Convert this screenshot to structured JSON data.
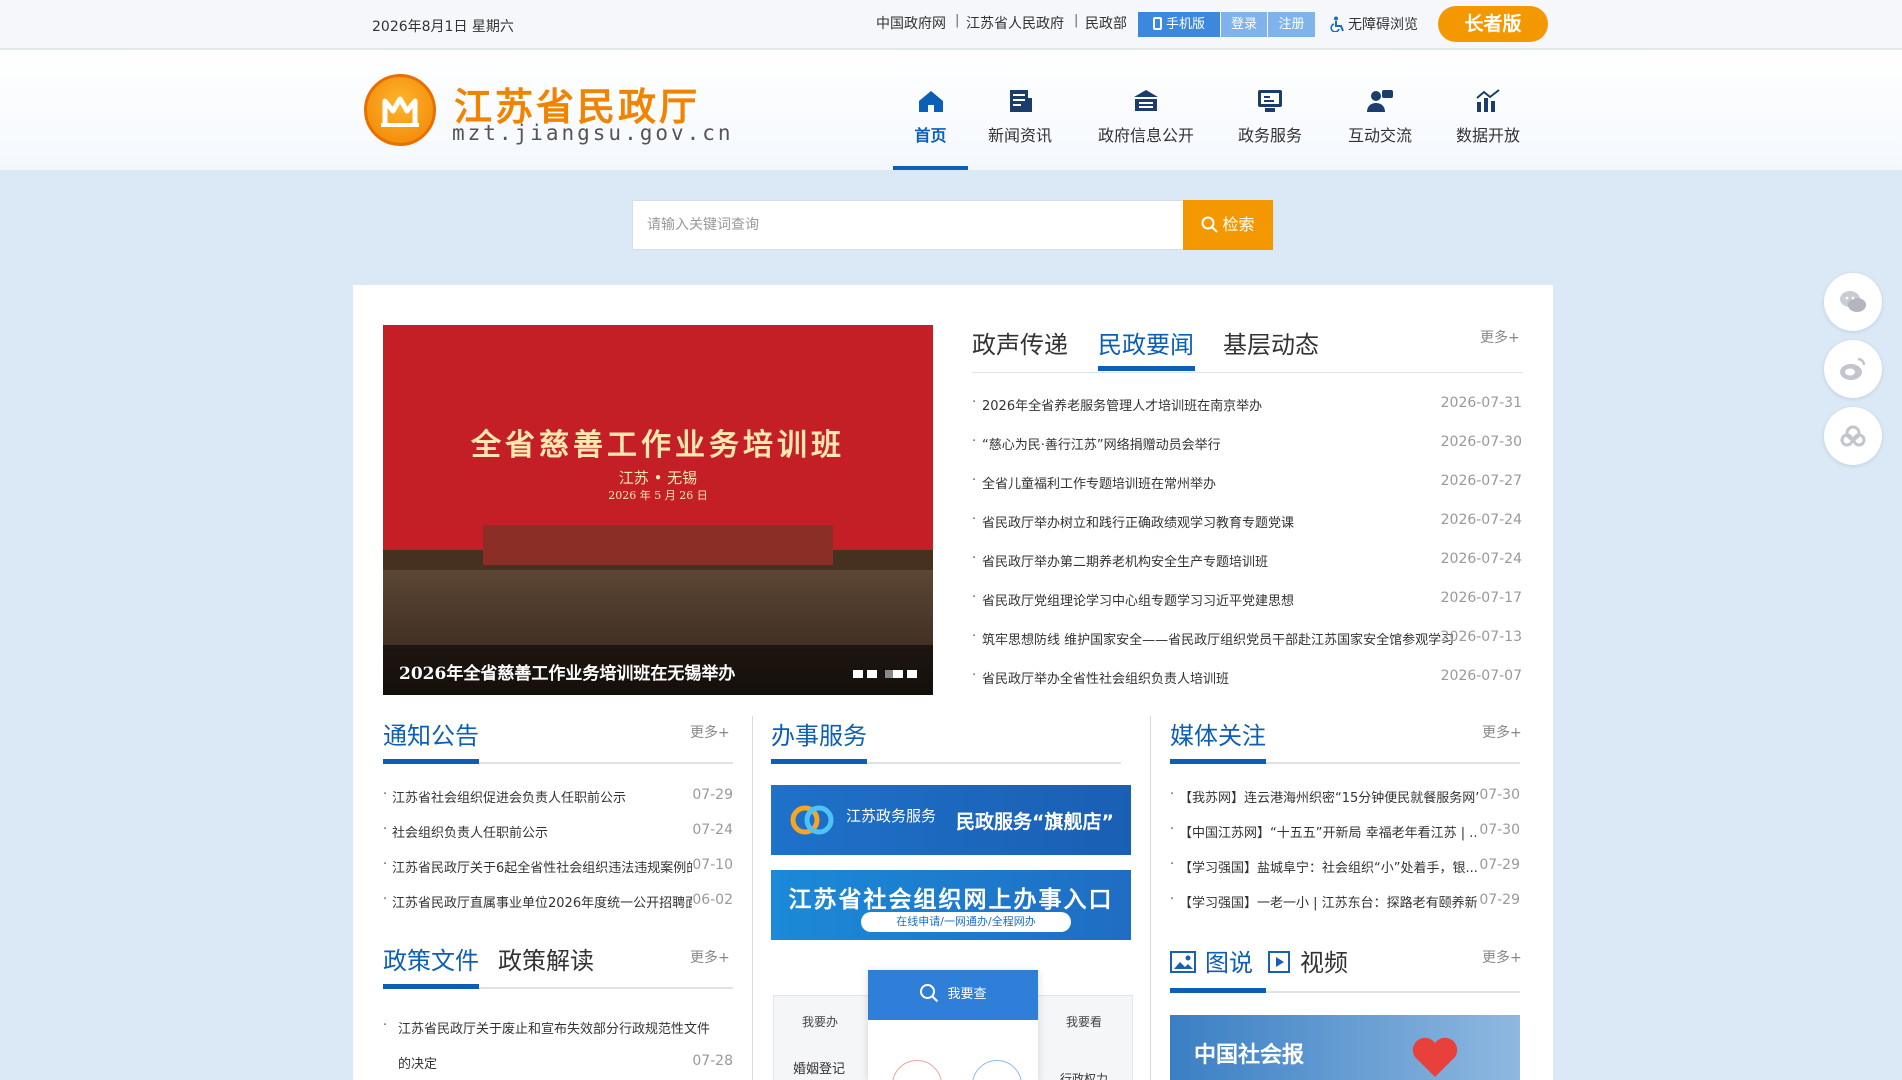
{
  "topbar": {
    "date": "2026年8月1日 星期六",
    "links": [
      "中国政府网",
      "江苏省人民政府",
      "民政部"
    ],
    "mobile": "手机版",
    "login": "登录",
    "register": "注册",
    "accessible": "无障碍浏览",
    "elder": "长者版"
  },
  "logo": {
    "cn": "江苏省民政厅",
    "en": "mzt.jiangsu.gov.cn"
  },
  "nav": [
    {
      "label": "首页",
      "icon": "home-icon",
      "active": true
    },
    {
      "label": "新闻资讯",
      "icon": "news-icon"
    },
    {
      "label": "政府信息公开",
      "icon": "gov-info-icon"
    },
    {
      "label": "政务服务",
      "icon": "service-icon"
    },
    {
      "label": "互动交流",
      "icon": "interact-icon"
    },
    {
      "label": "数据开放",
      "icon": "data-icon"
    }
  ],
  "search": {
    "placeholder": "请输入关键词查询",
    "button": "检索"
  },
  "slide": {
    "banner_title": "全省慈善工作业务培训班",
    "banner_sub": "江苏 • 无锡",
    "banner_date": "2026 年 5 月 26 日",
    "caption": "2026年全省慈善工作业务培训班在无锡举办"
  },
  "news": {
    "tabs": [
      "政声传递",
      "民政要闻",
      "基层动态"
    ],
    "active_tab": "民政要闻",
    "more": "更多+",
    "items": [
      {
        "title": "2026年全省养老服务管理人才培训班在南京举办",
        "date": "2026-07-31"
      },
      {
        "title": "“慈心为民·善行江苏”网络捐赠动员会举行",
        "date": "2026-07-30"
      },
      {
        "title": "全省儿童福利工作专题培训班在常州举办",
        "date": "2026-07-27"
      },
      {
        "title": "省民政厅举办树立和践行正确政绩观学习教育专题党课",
        "date": "2026-07-24"
      },
      {
        "title": "省民政厅举办第二期养老机构安全生产专题培训班",
        "date": "2026-07-24"
      },
      {
        "title": "省民政厅党组理论学习中心组专题学习习近平党建思想",
        "date": "2026-07-17"
      },
      {
        "title": "筑牢思想防线 维护国家安全——省民政厅组织党员干部赴江苏国家安全馆参观学习",
        "date": "2026-07-13"
      },
      {
        "title": "省民政厅举办全省性社会组织负责人培训班",
        "date": "2026-07-07"
      }
    ]
  },
  "notice": {
    "title": "通知公告",
    "more": "更多+",
    "items": [
      {
        "title": "江苏省社会组织促进会负责人任职前公示",
        "date": "07-29"
      },
      {
        "title": "社会组织负责人任职前公示",
        "date": "07-24"
      },
      {
        "title": "江苏省民政厅关于6起全省性社会组织违法违规案例的...",
        "date": "07-10"
      },
      {
        "title": "江苏省民政厅直属事业单位2026年度统一公开招聘面...",
        "date": "06-02"
      }
    ]
  },
  "policy": {
    "tabs": [
      "政策文件",
      "政策解读"
    ],
    "more": "更多+",
    "items": [
      {
        "title_line1": "江苏省民政厅关于废止和宣布失效部分行政规范性文件",
        "title_line2": "的决定",
        "date": "07-28"
      }
    ]
  },
  "service": {
    "title": "办事服务",
    "banner1_sub": "江苏政务服务",
    "banner1_text": "民政服务“旗舰店”",
    "banner2_text": "江苏省社会组织网上办事入口",
    "banner2_pill": "在线申请/一网通办/全程网办",
    "query_left": "我要办",
    "query_center": "我要查",
    "query_right": "我要看",
    "item_left": "婚姻登记",
    "item_right": "行政权力"
  },
  "media": {
    "title": "媒体关注",
    "more": "更多+",
    "items": [
      {
        "title": "【我苏网】连云港海州织密“15分钟便民就餐服务网”",
        "date": "07-30"
      },
      {
        "title": "【中国江苏网】“十五五”开新局 幸福老年看江苏 | ...",
        "date": "07-30"
      },
      {
        "title": "【学习强国】盐城阜宁：社会组织“小”处着手，银...",
        "date": "07-29"
      },
      {
        "title": "【学习强国】一老一小 | 江苏东台：探路老有颐养新...",
        "date": "07-29"
      }
    ],
    "tabs": [
      "图说",
      "视频"
    ],
    "more2": "更多+",
    "image_text": "中国社会报"
  },
  "float": [
    "wechat-icon",
    "weibo-icon",
    "cloud-icon"
  ],
  "colors": {
    "brand_blue": "#0d5fb5",
    "orange": "#f39800"
  }
}
